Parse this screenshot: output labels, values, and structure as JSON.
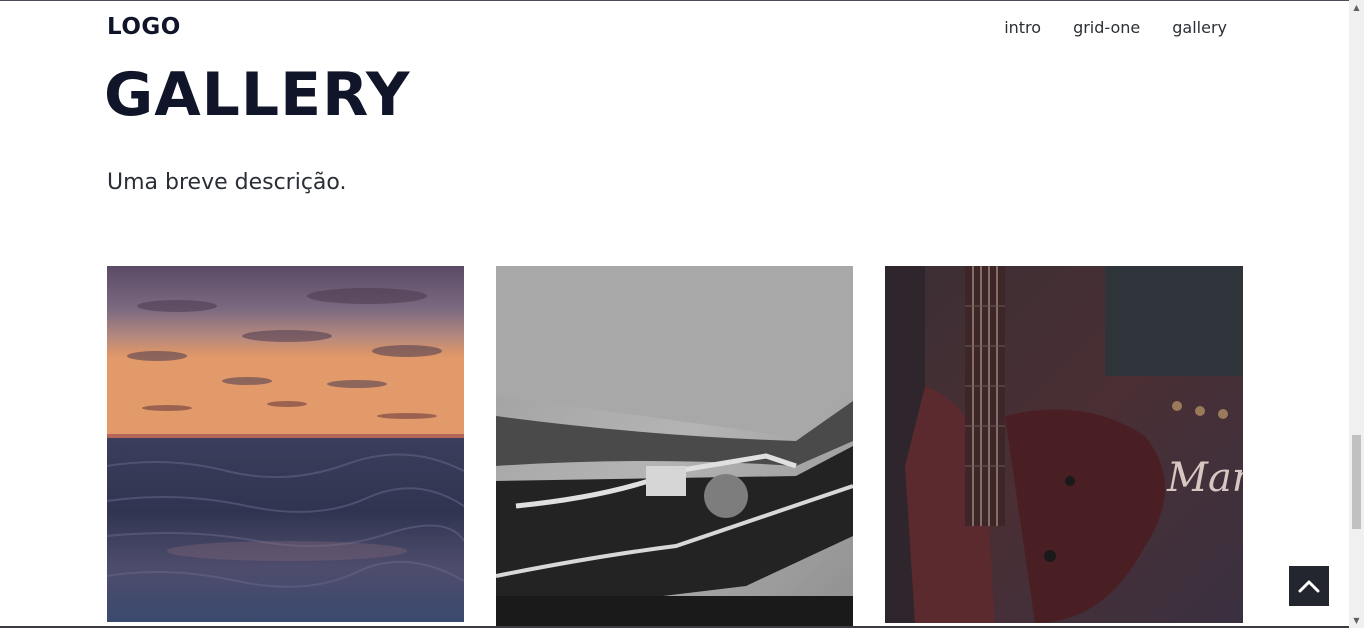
{
  "header": {
    "logo": "LOGO",
    "nav": [
      {
        "label": "intro"
      },
      {
        "label": "grid-one"
      },
      {
        "label": "gallery"
      }
    ]
  },
  "main": {
    "title": "GALLERY",
    "description": "Uma breve descrição."
  },
  "gallery": {
    "images": [
      {
        "subject": "ocean sunset"
      },
      {
        "subject": "car headlight"
      },
      {
        "subject": "guitar and amplifier"
      }
    ],
    "amp_text": "Mars"
  },
  "colors": {
    "heading": "#10152a",
    "back_to_top_bg": "#23262f"
  },
  "icons": {
    "back_to_top": "chevron-up-icon",
    "scroll_up": "scroll-up-arrow-icon",
    "scroll_down": "scroll-down-arrow-icon"
  }
}
